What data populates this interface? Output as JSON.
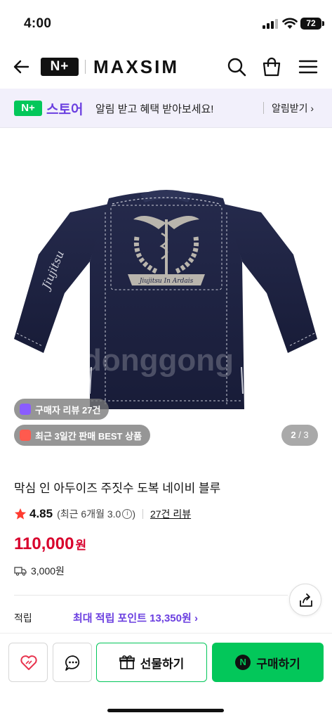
{
  "status_bar": {
    "time": "4:00",
    "battery": "72"
  },
  "header": {
    "badge": "N+",
    "brand": "MAXSIM"
  },
  "store_banner": {
    "badge": "N+",
    "store_label": "스토어",
    "message": "알림 받고 혜택 받아보세요!",
    "subscribe_label": "알림받기 ›"
  },
  "gallery": {
    "review_badge": "구매자 리뷰 27건",
    "best_badge": "최근 3일간 판매 BEST 상품",
    "current_page": "2",
    "total_pages": "/ 3",
    "garment_text": "Jiujitsu In Ardais",
    "watermark": "donggong"
  },
  "product": {
    "title": "막심 인 아두이즈 주짓수 도복 네이비 블루",
    "rating": "4.85",
    "recent_rating": "(최근 6개월 3.0",
    "review_link": "27건 리뷰",
    "price": "110,000",
    "price_unit": "원",
    "shipping": "3,000원",
    "points_label": "적립",
    "points_value": "최대 적립 포인트 13,350원 ›"
  },
  "bottom_bar": {
    "gift_label": "선물하기",
    "buy_label": "구매하기",
    "buy_badge": "N"
  },
  "colors": {
    "naver_green": "#03c75a",
    "store_purple": "#6b3fe0",
    "price_red": "#d8002c",
    "gi_navy": "#1d2242"
  }
}
